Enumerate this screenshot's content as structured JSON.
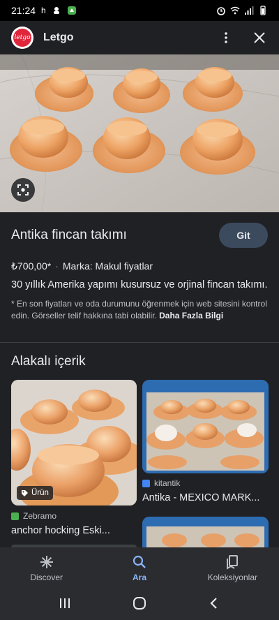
{
  "status_bar": {
    "time": "21:24",
    "extra": "h"
  },
  "header": {
    "app_name": "Letgo",
    "logo_text": "letgo"
  },
  "product": {
    "title": "Antika fincan takımı",
    "go_button": "Git",
    "price": "₺700,00*",
    "separator": "·",
    "brand": "Marka: Makul fiyatlar",
    "description": "30 yıllık Amerika yapımı kusursuz ve orjinal fincan takımı.",
    "disclaimer": "* En son fiyatları ve oda durumunu öğrenmek için web sitesini kontrol edin. Görseller telif hakkına tabi olabilir.",
    "more_link": "Daha Fazla Bilgi"
  },
  "related": {
    "title": "Alakalı içerik",
    "items": [
      {
        "badge": "Ürün",
        "source": "Zebramo",
        "caption": "anchor hocking Eski...",
        "source_color": "#4caf50"
      },
      {
        "source": "kitantik",
        "caption": "Antika - MEXICO MARK...",
        "source_color": "#4285f4"
      }
    ]
  },
  "bottom_nav": {
    "items": [
      {
        "label": "Discover",
        "icon": "asterisk-icon"
      },
      {
        "label": "Ara",
        "icon": "search-icon"
      },
      {
        "label": "Koleksiyonlar",
        "icon": "collections-icon"
      }
    ],
    "active": "Ara"
  },
  "colors": {
    "accent": "#8ab4f8",
    "background": "#202124",
    "cup": "#e8a05c"
  }
}
